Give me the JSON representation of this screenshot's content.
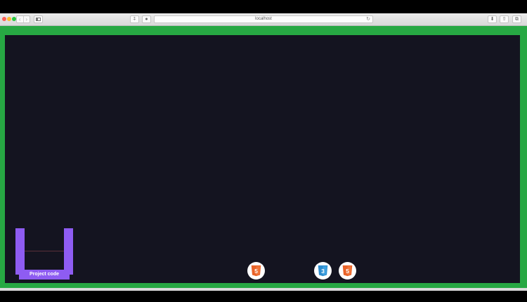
{
  "browser": {
    "address": "localhost",
    "nav_back": "‹",
    "nav_forward": "›",
    "share_left": "⍏",
    "shield": "●",
    "reload": "↻",
    "download": "⬇",
    "share": "⇧",
    "tabs": "⧉"
  },
  "game": {
    "bucket_label": "Project code",
    "logos": [
      {
        "icon": "html5-icon",
        "text": "5",
        "color": "#e96228"
      },
      {
        "icon": "css3-icon",
        "text": "3",
        "color": "#2d8ccd"
      },
      {
        "icon": "html5-icon",
        "text": "5",
        "color": "#e96228"
      }
    ]
  },
  "colors": {
    "frame_green": "#27a843",
    "canvas_bg": "#141420",
    "bucket_purple": "#8e5cf2"
  }
}
